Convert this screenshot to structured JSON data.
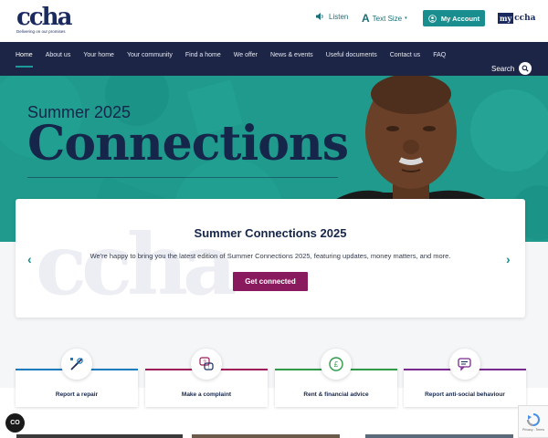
{
  "brand": {
    "logo_text": "ccha",
    "tagline": "Delivering on our promises",
    "myccha_my": "my",
    "myccha_rest": "ccha"
  },
  "utility": {
    "listen": "Listen",
    "text_size": "Text Size",
    "text_size_glyph": "A",
    "my_account": "My Account"
  },
  "nav": {
    "items": [
      "Home",
      "About us",
      "Your home",
      "Your community",
      "Find a home",
      "We offer",
      "News & events",
      "Useful documents",
      "Contact us",
      "FAQ"
    ],
    "active_index": 0,
    "search": "Search"
  },
  "hero": {
    "subtitle": "Summer 2025",
    "title": "Connections"
  },
  "slide": {
    "title": "Summer Connections 2025",
    "description": "We're happy to bring you the latest edition of Summer Connections 2025, featuring updates, money matters, and more.",
    "button": "Get connected",
    "watermark": "ccha"
  },
  "quick_links": [
    {
      "label": "Report a repair",
      "icon": "tools-icon",
      "color": "#1a7bbf"
    },
    {
      "label": "Make a complaint",
      "icon": "complaint-icon",
      "color": "#a01a5a"
    },
    {
      "label": "Rent & financial advice",
      "icon": "money-icon",
      "color": "#2e9a48"
    },
    {
      "label": "Report anti-social behaviour",
      "icon": "chat-icon",
      "color": "#7a2a8e"
    }
  ],
  "cookie": {
    "label": "CO"
  },
  "recaptcha": {
    "links": "Privacy - Terms"
  },
  "colors": {
    "navy": "#1c2545",
    "teal": "#1a8e8e",
    "magenta": "#8a1a5e"
  }
}
